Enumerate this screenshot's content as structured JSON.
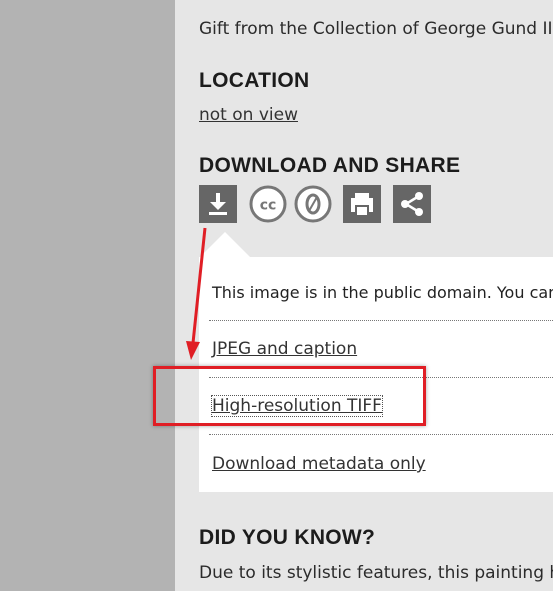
{
  "credit_text": "Gift from the Collection of George Gund II",
  "location": {
    "heading": "LOCATION",
    "status_link": "not on view"
  },
  "download_share": {
    "heading": "DOWNLOAD AND SHARE",
    "icons": [
      "download-icon",
      "creative-commons-icon",
      "cc-zero-icon",
      "print-icon",
      "share-icon"
    ],
    "panel": {
      "notice": "This image is in the public domain. You can",
      "links": [
        "JPEG and caption",
        "High-resolution TIFF",
        "Download metadata only"
      ]
    }
  },
  "did_you_know": {
    "heading": "DID YOU KNOW?",
    "text": "Due to its stylistic features, this painting ha"
  },
  "annotation_color": "#e01e25"
}
